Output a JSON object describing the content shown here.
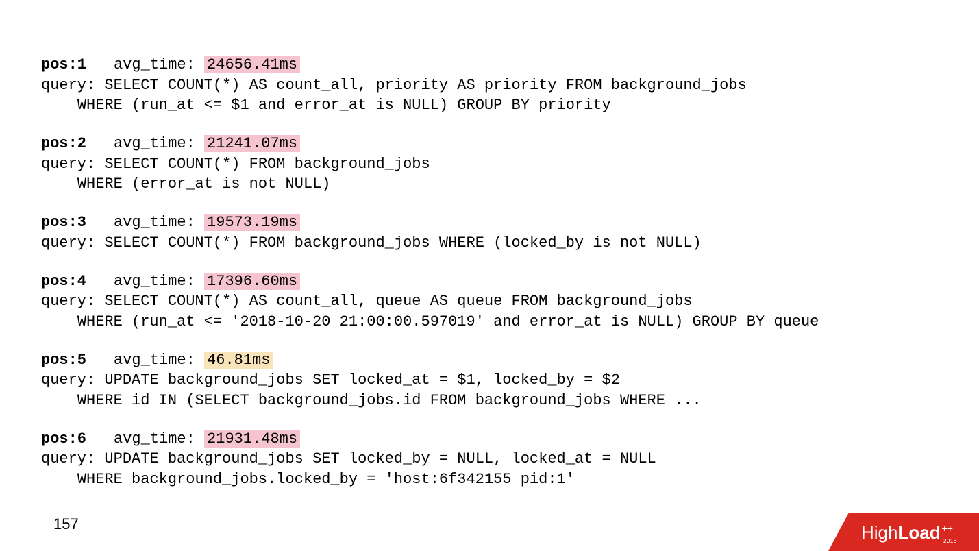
{
  "pageNumber": "157",
  "avgTimeLabel": "avg_time: ",
  "queryLabel": "query: ",
  "entries": [
    {
      "pos": "pos:1",
      "time": "24656.41ms",
      "hl": "pink",
      "query": "SELECT COUNT(*) AS count_all, priority AS priority FROM background_jobs\n    WHERE (run_at <= $1 and error_at is NULL) GROUP BY priority"
    },
    {
      "pos": "pos:2",
      "time": "21241.07ms",
      "hl": "pink",
      "query": "SELECT COUNT(*) FROM background_jobs\n    WHERE (error_at is not NULL)"
    },
    {
      "pos": "pos:3",
      "time": "19573.19ms",
      "hl": "pink",
      "query": "SELECT COUNT(*) FROM background_jobs WHERE (locked_by is not NULL)"
    },
    {
      "pos": "pos:4",
      "time": "17396.60ms",
      "hl": "pink",
      "query": "SELECT COUNT(*) AS count_all, queue AS queue FROM background_jobs\n    WHERE (run_at <= '2018-10-20 21:00:00.597019' and error_at is NULL) GROUP BY queue"
    },
    {
      "pos": "pos:5",
      "time": "46.81ms",
      "hl": "yellow",
      "query": "UPDATE background_jobs SET locked_at = $1, locked_by = $2\n    WHERE id IN (SELECT background_jobs.id FROM background_jobs WHERE ..."
    },
    {
      "pos": "pos:6",
      "time": "21931.48ms",
      "hl": "pink",
      "query": "UPDATE background_jobs SET locked_by = NULL, locked_at = NULL\n    WHERE background_jobs.locked_by = 'host:6f342155 pid:1'"
    }
  ],
  "badge": {
    "brandLight": "High",
    "brandBold": "Load",
    "plus": "++",
    "year": "2018",
    "color": "#d9281f"
  }
}
